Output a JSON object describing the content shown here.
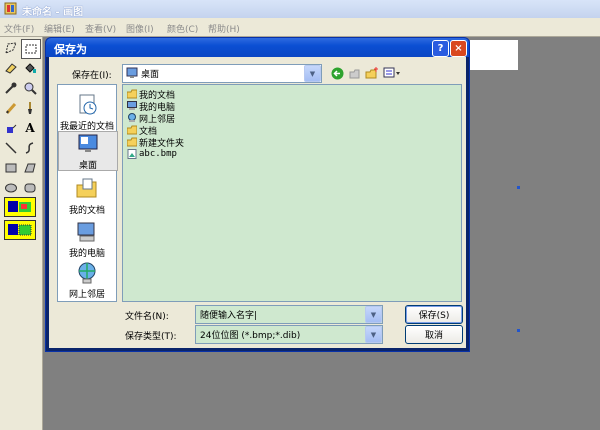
{
  "paint_window": {
    "title": "未命名 - 画图",
    "menu": [
      "文件(F)",
      "编辑(E)",
      "查看(V)",
      "图像(I)",
      "颜色(C)",
      "帮助(H)"
    ]
  },
  "dialog": {
    "title": "保存为",
    "help_button": "?",
    "close_button": "×",
    "save_in_label": "保存在(I):",
    "save_in_value": "桌面",
    "places": [
      {
        "label": "我最近的文档",
        "icon": "recent-documents-icon"
      },
      {
        "label": "桌面",
        "icon": "desktop-icon"
      },
      {
        "label": "我的文档",
        "icon": "my-documents-icon"
      },
      {
        "label": "我的电脑",
        "icon": "my-computer-icon"
      },
      {
        "label": "网上邻居",
        "icon": "network-places-icon"
      }
    ],
    "files": [
      {
        "name": "我的文档",
        "icon": "folder-docs-icon"
      },
      {
        "name": "我的电脑",
        "icon": "computer-icon"
      },
      {
        "name": "网上邻居",
        "icon": "network-icon"
      },
      {
        "name": "文档",
        "icon": "folder-icon"
      },
      {
        "name": "新建文件夹",
        "icon": "folder-icon"
      },
      {
        "name": "abc.bmp",
        "icon": "bitmap-file-icon"
      }
    ],
    "filename_label": "文件名(N):",
    "filename_value": "随便输入名字|",
    "filetype_label": "保存类型(T):",
    "filetype_value": "24位位图 (*.bmp;*.dib)",
    "save_button": "保存(S)",
    "cancel_button": "取消"
  },
  "colors": {
    "title_blue": "#0a46c4",
    "file_list_bg": "#cfe8cf",
    "dialog_bg": "#ece9d8",
    "workspace_gray": "#808080"
  }
}
